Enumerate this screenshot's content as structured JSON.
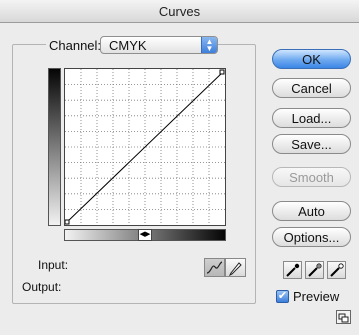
{
  "window": {
    "title": "Curves"
  },
  "channel": {
    "label": "Channel:",
    "value": "CMYK"
  },
  "curve": {
    "input_points": [
      0,
      100
    ],
    "output_points": [
      0,
      100
    ]
  },
  "readouts": {
    "input_label": "Input:",
    "output_label": "Output:"
  },
  "buttons": {
    "ok": "OK",
    "cancel": "Cancel",
    "load": "Load...",
    "save": "Save...",
    "smooth": "Smooth",
    "auto": "Auto",
    "options": "Options..."
  },
  "preview": {
    "label": "Preview",
    "checked": true
  },
  "icons": {
    "curve_mode": "curve-icon",
    "pencil_mode": "pencil-icon",
    "eyedroppers": [
      "black-eyedropper-icon",
      "gray-eyedropper-icon",
      "white-eyedropper-icon"
    ],
    "expand": "expand-icon"
  },
  "colors": {
    "accent": "#3b86e6"
  }
}
